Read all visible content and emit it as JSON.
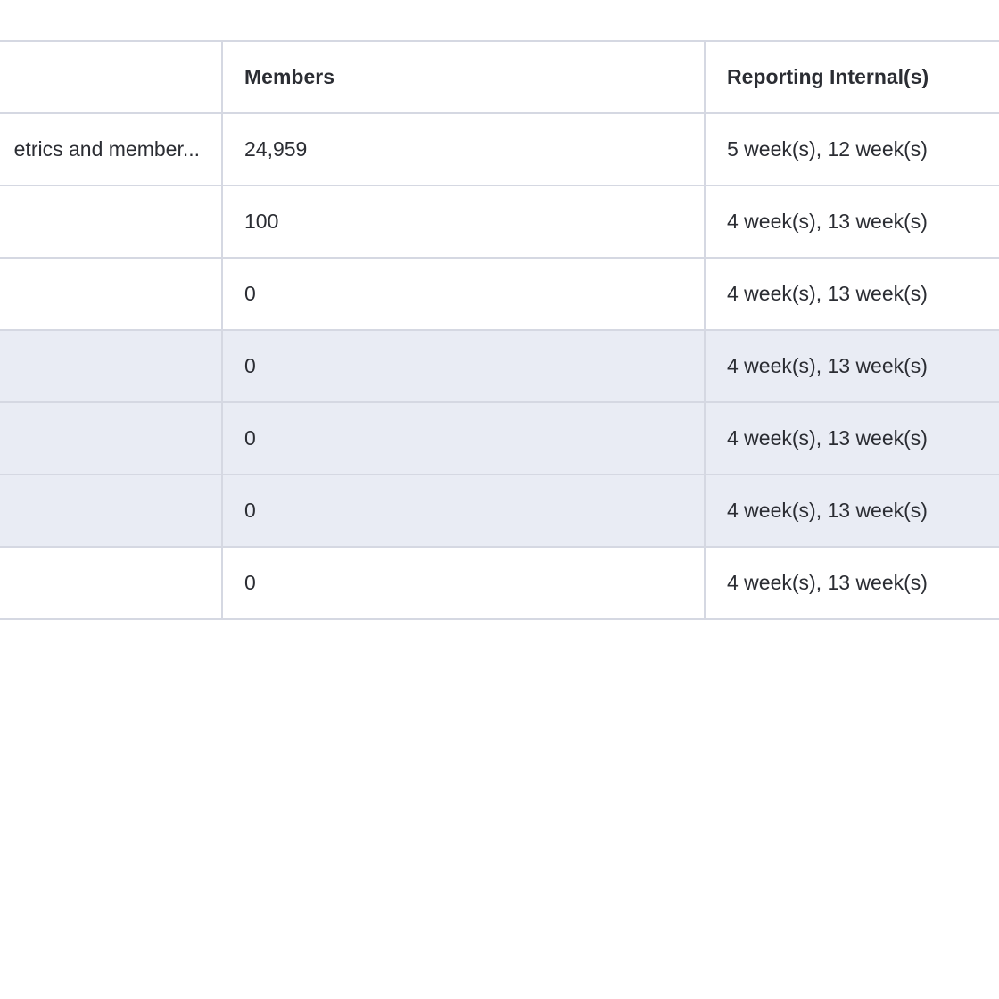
{
  "table": {
    "columns": {
      "description": "",
      "members": "Members",
      "reporting": "Reporting Internal(s)"
    },
    "rows": [
      {
        "description": "etrics and member...",
        "members": "24,959",
        "reporting": "5 week(s), 12 week(s)",
        "highlighted": false
      },
      {
        "description": "",
        "members": "100",
        "reporting": "4 week(s), 13 week(s)",
        "highlighted": false
      },
      {
        "description": "",
        "members": "0",
        "reporting": "4 week(s), 13 week(s)",
        "highlighted": false
      },
      {
        "description": "",
        "members": "0",
        "reporting": "4 week(s), 13 week(s)",
        "highlighted": true
      },
      {
        "description": "",
        "members": "0",
        "reporting": "4 week(s), 13 week(s)",
        "highlighted": true
      },
      {
        "description": "",
        "members": "0",
        "reporting": "4 week(s), 13 week(s)",
        "highlighted": true
      },
      {
        "description": "",
        "members": "0",
        "reporting": "4 week(s), 13 week(s)",
        "highlighted": false
      }
    ]
  },
  "colors": {
    "border": "#d5d8e2",
    "highlight_row": "#e9ecf4",
    "text": "#2b2d33"
  }
}
